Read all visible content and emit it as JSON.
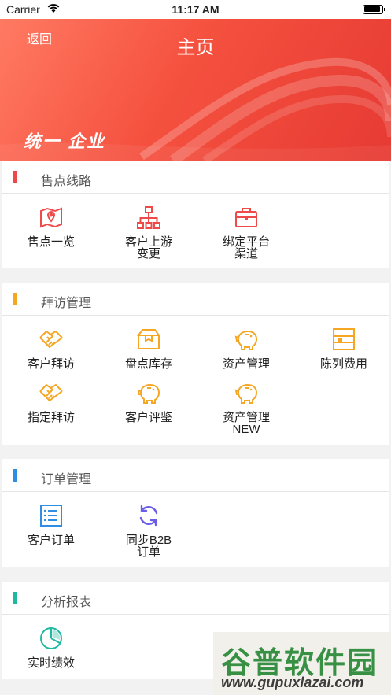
{
  "status_bar": {
    "carrier": "Carrier",
    "time": "11:17 AM"
  },
  "header": {
    "back_label": "返回",
    "title": "主页",
    "brand": "统一 企业"
  },
  "sections": [
    {
      "title": "售点线路",
      "accent": "#f0484a",
      "items": [
        "售点一览",
        "客户上游变更",
        "绑定平台渠道"
      ]
    },
    {
      "title": "拜访管理",
      "accent": "#f5a623",
      "items": [
        "客户拜访",
        "盘点库存",
        "资产管理",
        "陈列费用",
        "指定拜访",
        "客户评鉴",
        "资产管理NEW"
      ]
    },
    {
      "title": "订单管理",
      "accent": "#2f8de4",
      "items": [
        "客户订单",
        "同步B2B订单"
      ]
    },
    {
      "title": "分析报表",
      "accent": "#1fb8a0",
      "items": [
        "实时绩效"
      ]
    }
  ],
  "icons": {
    "s0": [
      "map-icon",
      "org-chart-icon",
      "toolbox-icon"
    ],
    "s1": [
      "handshake-icon",
      "box-icon",
      "piggy-bank-icon",
      "shelf-icon",
      "handshake-icon",
      "piggy-bank-icon",
      "piggy-bank-icon"
    ],
    "s2": [
      "list-icon",
      "sync-icon"
    ],
    "s3": [
      "pie-chart-icon"
    ]
  },
  "watermark": {
    "title": "谷普软件园",
    "url": "www.gupuxlazai.com"
  }
}
